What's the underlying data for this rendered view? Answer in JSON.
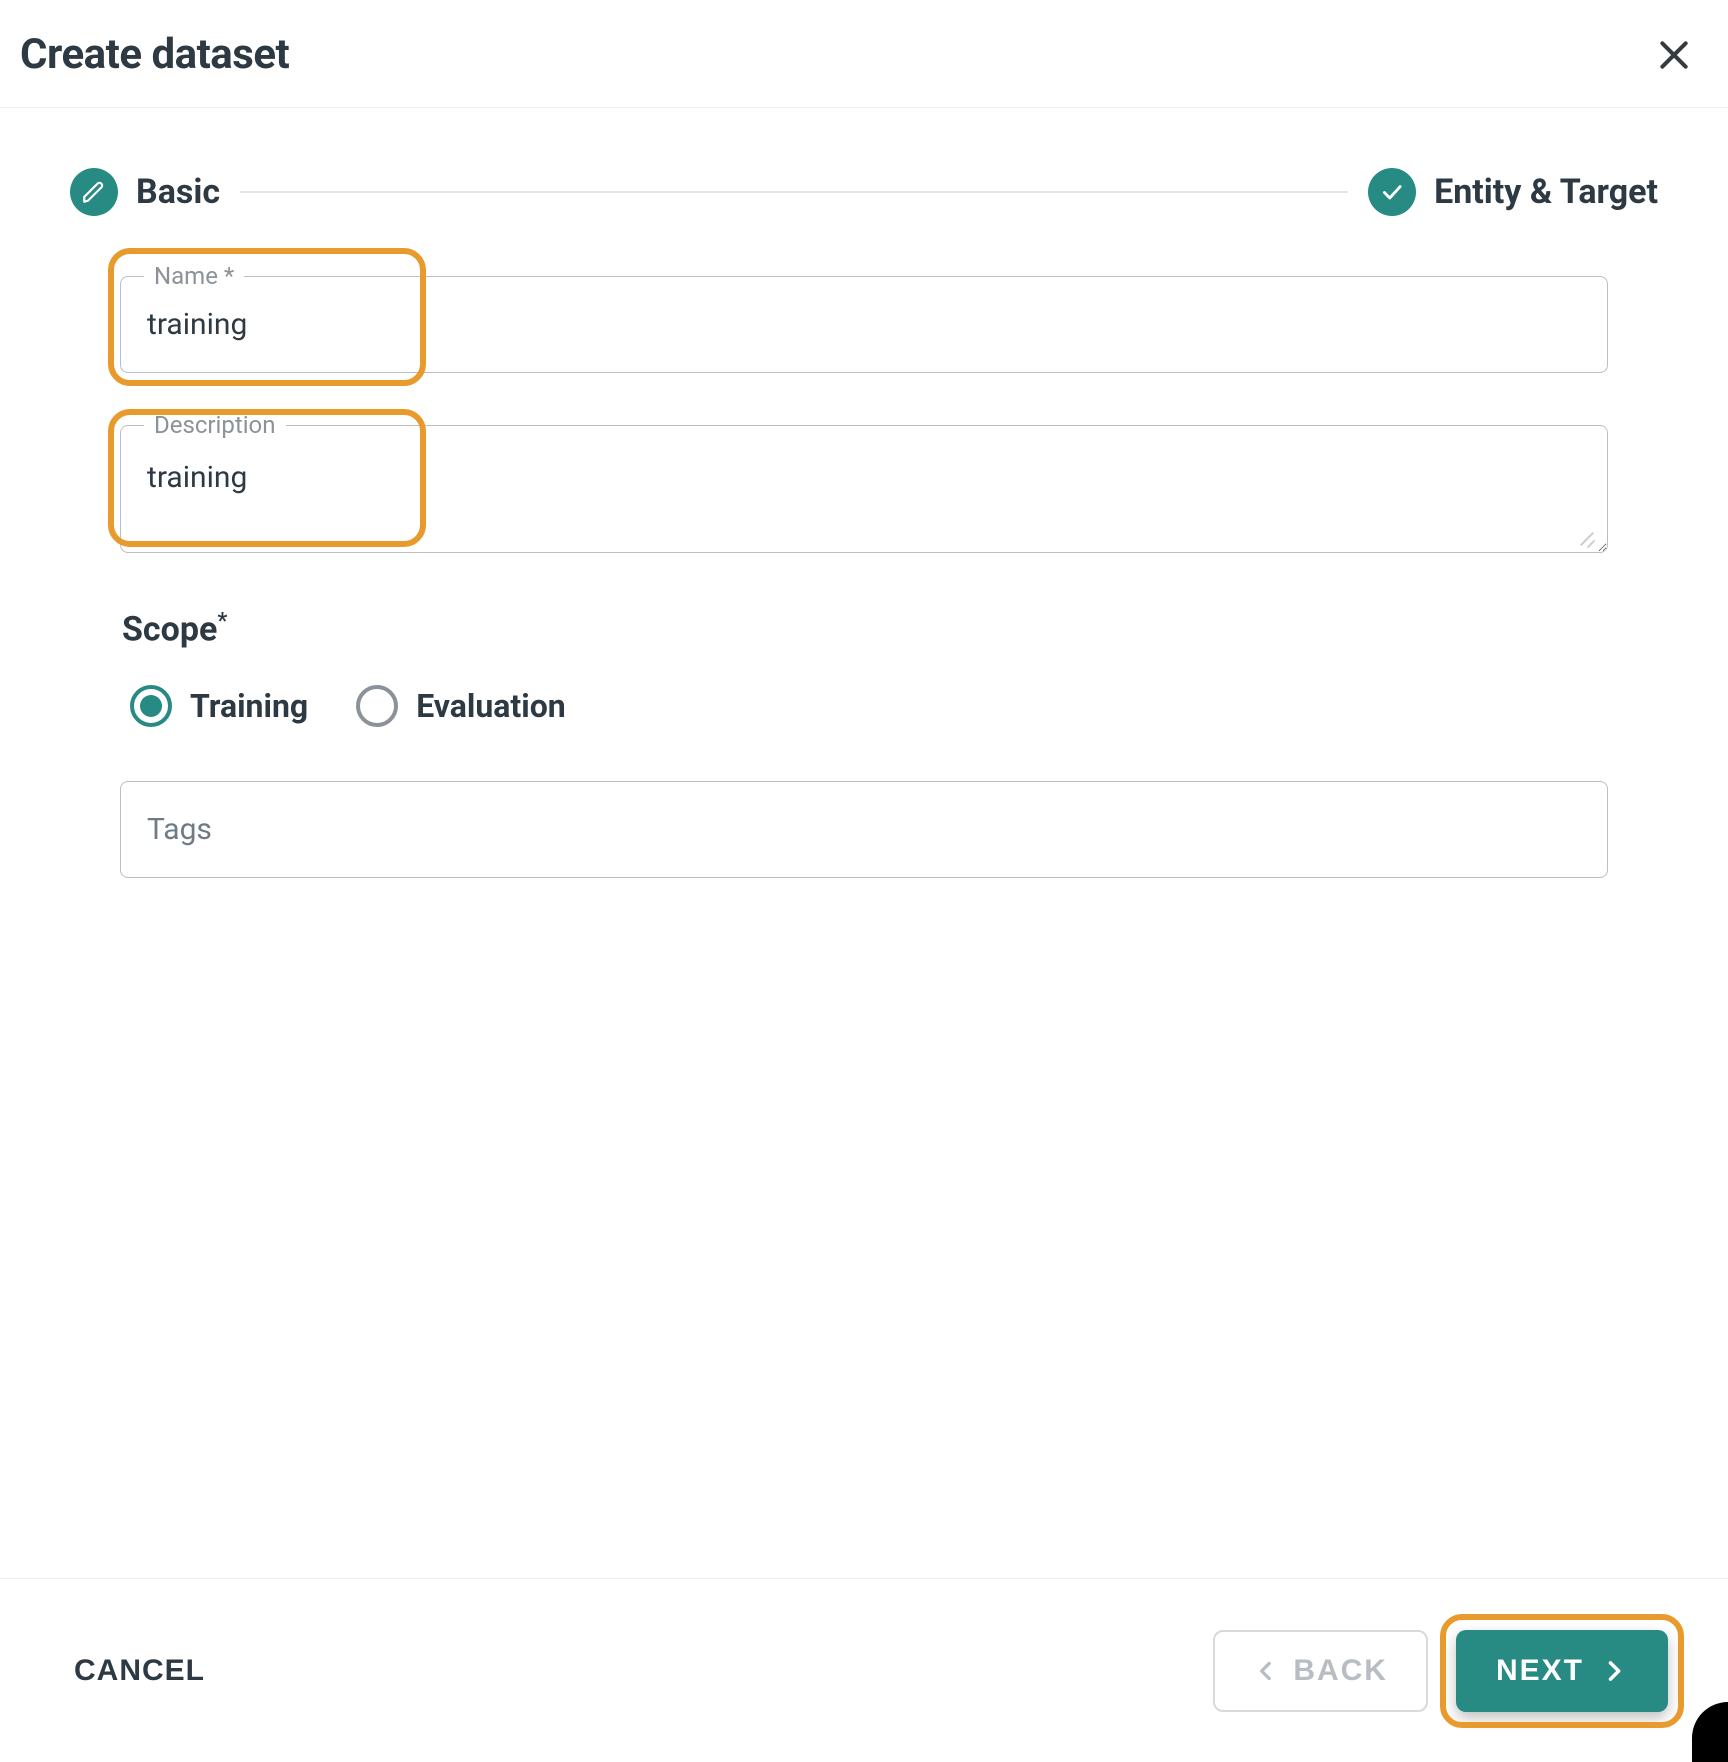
{
  "dialog": {
    "title": "Create dataset"
  },
  "stepper": {
    "step1": {
      "label": "Basic",
      "icon": "pencil-icon"
    },
    "step2": {
      "label": "Entity & Target",
      "icon": "check-icon"
    }
  },
  "form": {
    "name": {
      "label": "Name *",
      "value": "training"
    },
    "description": {
      "label": "Description",
      "value": "training"
    },
    "scope": {
      "title": "Scope",
      "asterisk": "*",
      "options": [
        {
          "label": "Training",
          "selected": true
        },
        {
          "label": "Evaluation",
          "selected": false
        }
      ]
    },
    "tags": {
      "placeholder": "Tags",
      "value": ""
    }
  },
  "footer": {
    "cancel": "CANCEL",
    "back": "BACK",
    "next": "NEXT"
  },
  "colors": {
    "accent": "#278B83",
    "highlight": "#E89B2C"
  }
}
